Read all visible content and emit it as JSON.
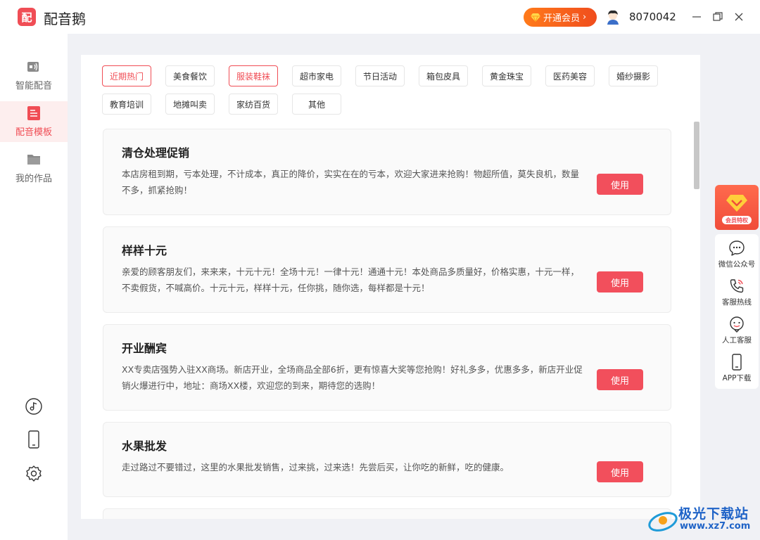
{
  "app": {
    "logo_char": "配",
    "title": "配音鹅"
  },
  "header": {
    "vip_label": "开通会员",
    "vip_arrow": "›",
    "user_id": "8070042"
  },
  "sidebar": {
    "items": [
      {
        "label": "智能配音",
        "icon": "voice-icon"
      },
      {
        "label": "配音模板",
        "icon": "template-icon"
      },
      {
        "label": "我的作品",
        "icon": "folder-icon"
      }
    ],
    "tools": [
      "music-icon",
      "phone-icon",
      "settings-icon"
    ]
  },
  "tags": [
    {
      "label": "近期热门",
      "selected": true
    },
    {
      "label": "美食餐饮",
      "selected": false
    },
    {
      "label": "服装鞋袜",
      "selected": true
    },
    {
      "label": "超市家电",
      "selected": false
    },
    {
      "label": "节日活动",
      "selected": false
    },
    {
      "label": "箱包皮具",
      "selected": false
    },
    {
      "label": "黄金珠宝",
      "selected": false
    },
    {
      "label": "医药美容",
      "selected": false
    },
    {
      "label": "婚纱摄影",
      "selected": false
    },
    {
      "label": "教育培训",
      "selected": false
    },
    {
      "label": "地摊叫卖",
      "selected": false
    },
    {
      "label": "家纺百货",
      "selected": false
    },
    {
      "label": "其他",
      "selected": false
    }
  ],
  "cards": [
    {
      "title": "清仓处理促销",
      "desc": "本店房租到期，亏本处理，不计成本，真正的降价，实实在在的亏本，欢迎大家进来抢购！物超所值，莫失良机，数量不多，抓紧抢购！",
      "button": "使用"
    },
    {
      "title": "样样十元",
      "desc": "亲爱的顾客朋友们，来来来，十元十元！全场十元！一律十元！通通十元！本处商品多质量好，价格实惠，十元一样，不卖假货，不喊高价。十元十元，样样十元，任你挑，随你选，每样都是十元！",
      "button": "使用"
    },
    {
      "title": "开业酬宾",
      "desc": "XX专卖店强势入驻XX商场。新店开业，全场商品全部6折，更有惊喜大奖等您抢购！好礼多多，优惠多多，新店开业促销火爆进行中，地址：商场XX楼，欢迎您的到来，期待您的选购！",
      "button": "使用"
    },
    {
      "title": "水果批发",
      "desc": "走过路过不要错过，这里的水果批发销售，过来挑，过来选！先尝后买，让你吃的新鲜，吃的健康。",
      "button": "使用"
    }
  ],
  "float_panel": {
    "vip_label": "会员特权",
    "items": [
      {
        "label": "微信公众号",
        "icon": "wechat-icon"
      },
      {
        "label": "客服热线",
        "icon": "hotline-icon"
      },
      {
        "label": "人工客服",
        "icon": "chat-icon"
      },
      {
        "label": "APP下载",
        "icon": "mobile-icon"
      }
    ]
  },
  "watermark": {
    "line1": "极光下载站",
    "line2": "www.xz7.com"
  },
  "colors": {
    "accent": "#f04d55",
    "vip_orange": "#ff7a1a",
    "watermark_blue": "#1f63c7"
  }
}
